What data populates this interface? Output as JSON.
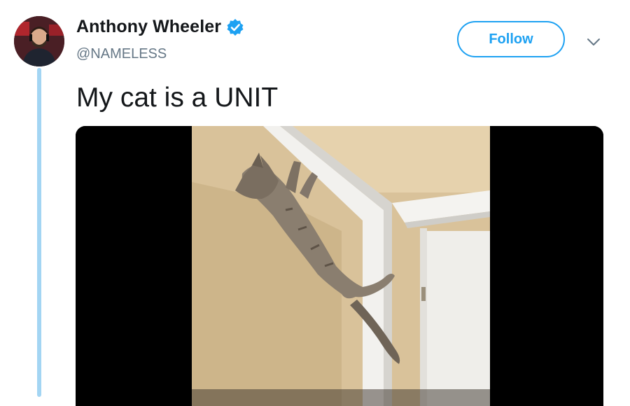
{
  "tweet": {
    "author": {
      "display_name": "Anthony Wheeler",
      "handle": "@NAMELESS",
      "verified": true,
      "avatar_icon": "avatar-photo"
    },
    "follow_label": "Follow",
    "menu_icon": "chevron-down-icon",
    "text": "My cat is a UNIT",
    "media": {
      "kind": "video",
      "description_icon": "video-frame"
    }
  },
  "colors": {
    "accent": "#1da1f2",
    "thread_line": "#a3d5f3",
    "name": "#14171a",
    "handle": "#657786"
  }
}
